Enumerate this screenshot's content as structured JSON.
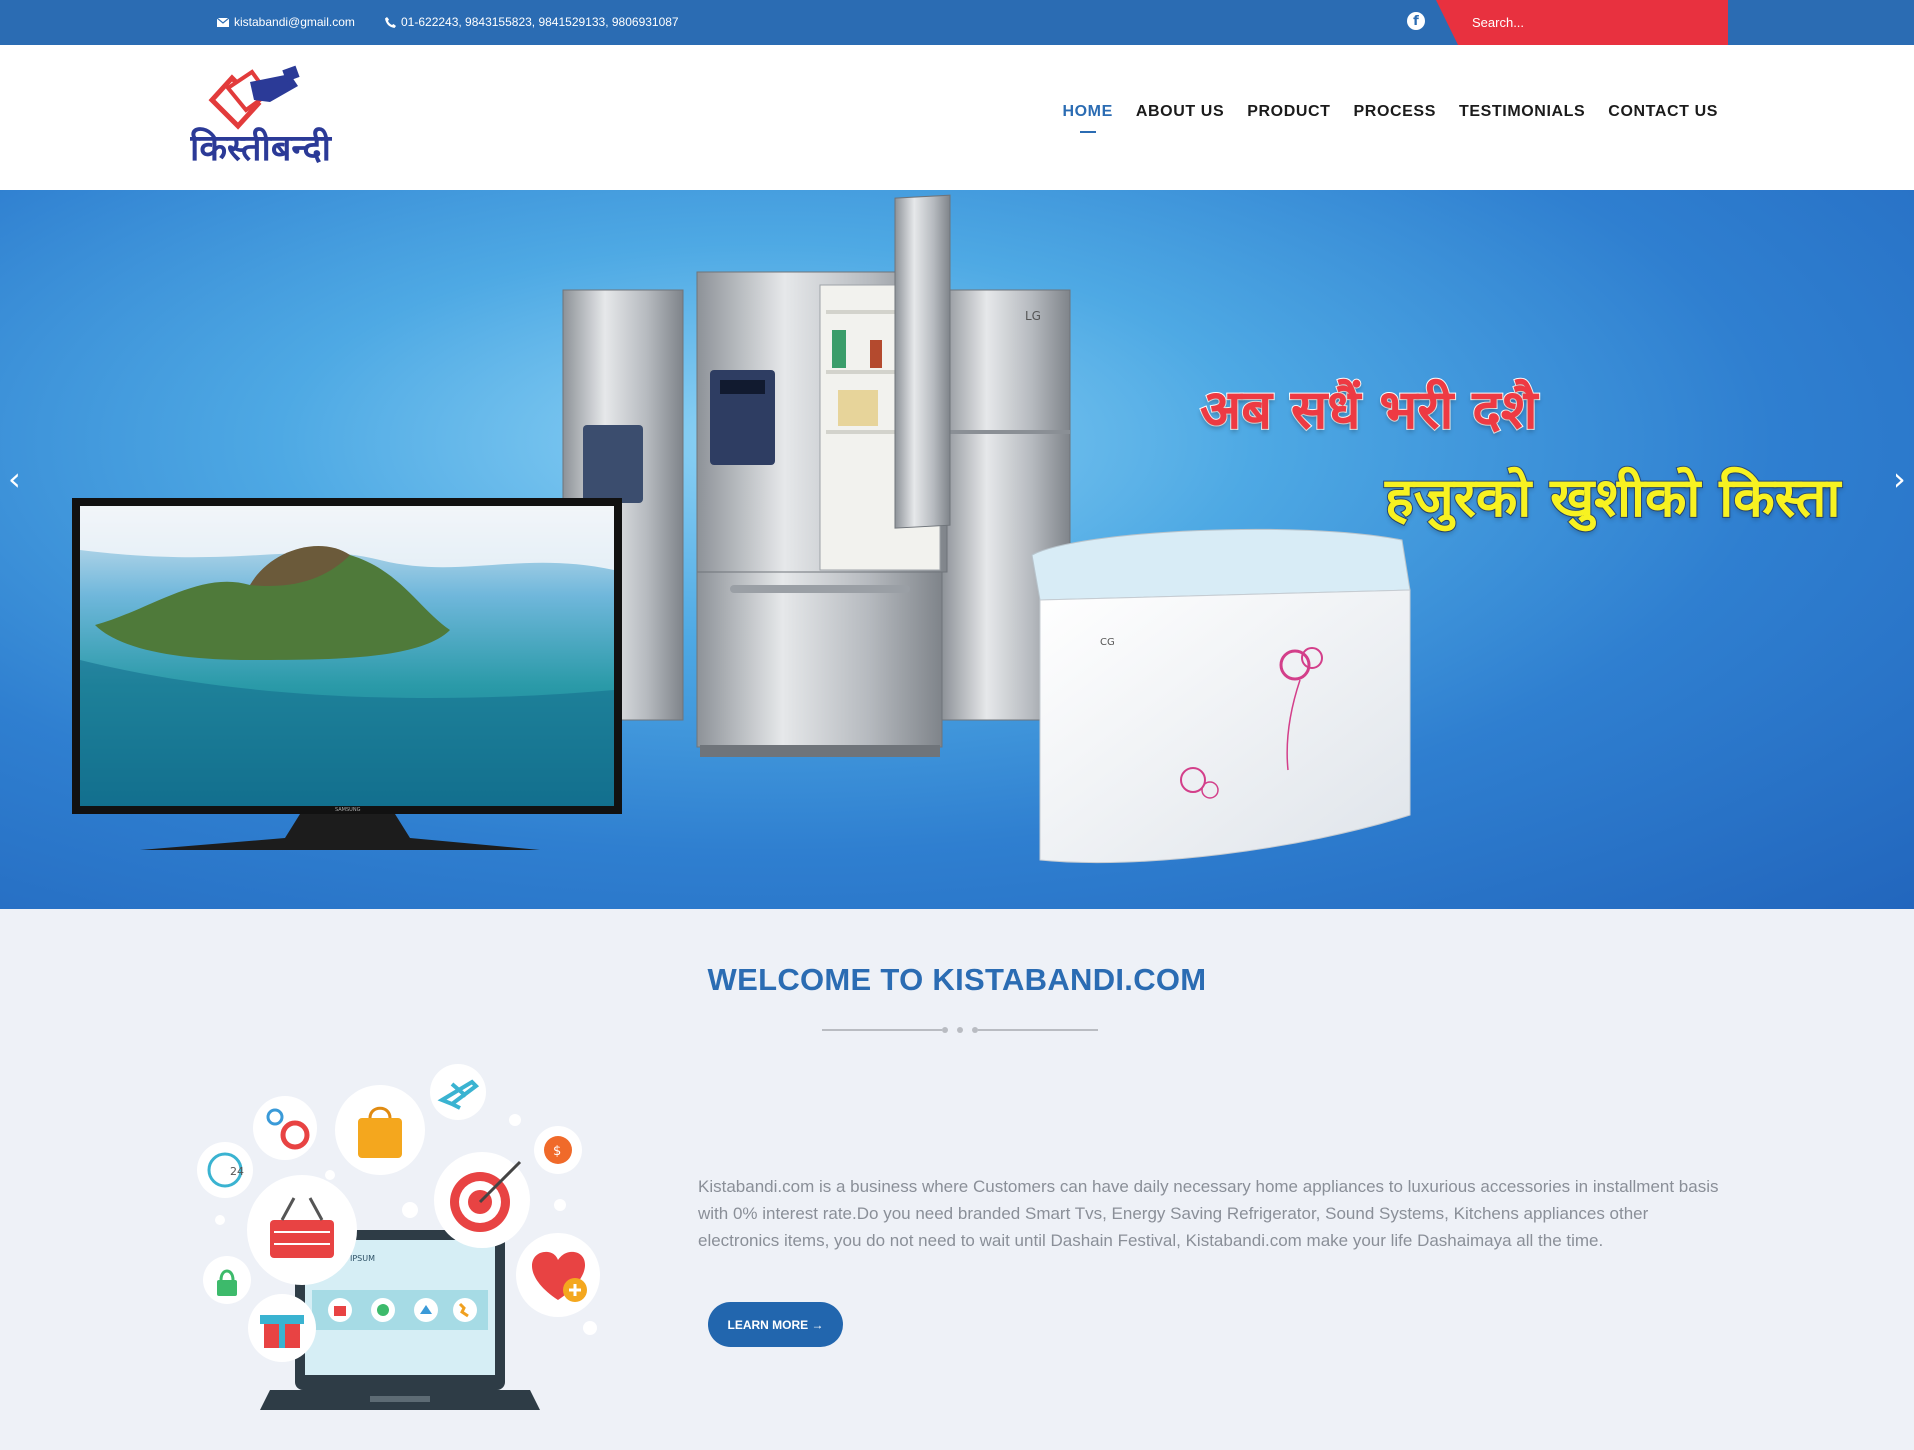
{
  "topbar": {
    "email": "kistabandi@gmail.com",
    "phone": "01-622243, 9843155823, 9841529133, 9806931087",
    "social_icon": "facebook-icon",
    "search_placeholder": "Search..."
  },
  "logo": {
    "text": "किस्तीबन्दी"
  },
  "nav": {
    "items": [
      {
        "label": "HOME",
        "active": true
      },
      {
        "label": "ABOUT US"
      },
      {
        "label": "PRODUCT"
      },
      {
        "label": "PROCESS"
      },
      {
        "label": "TESTIMONIALS"
      },
      {
        "label": "CONTACT US"
      }
    ]
  },
  "hero": {
    "slogan_line1": "अब सधैं भरी दशै",
    "slogan_line2": "हजुरको खुशीको किस्ता",
    "prev_arrow": "‹",
    "next_arrow": "›",
    "tv_brand": "SAMSUNG",
    "fridge_brand": "LG",
    "freezer_brand": "CG"
  },
  "welcome": {
    "title": "WELCOME TO KISTABANDI.COM",
    "description": "Kistabandi.com is a business where Customers can have daily necessary home appliances to luxurious accessories in installment basis with 0% interest rate.Do you need branded Smart Tvs, Energy Saving Refrigerator, Sound Systems, Kitchens appliances other electronics items, you do not need to wait until Dashain Festival, Kistabandi.com make your life Dashaimaya all the time.",
    "button": "LEARN MORE →",
    "illustration_label": "IPSUM",
    "clock_label": "24"
  },
  "colors": {
    "primary_blue": "#2b6cb3",
    "accent_red": "#e8313f",
    "slogan_red": "#ee3a43",
    "slogan_yellow": "#f7f221",
    "body_text": "#8a8f98"
  }
}
